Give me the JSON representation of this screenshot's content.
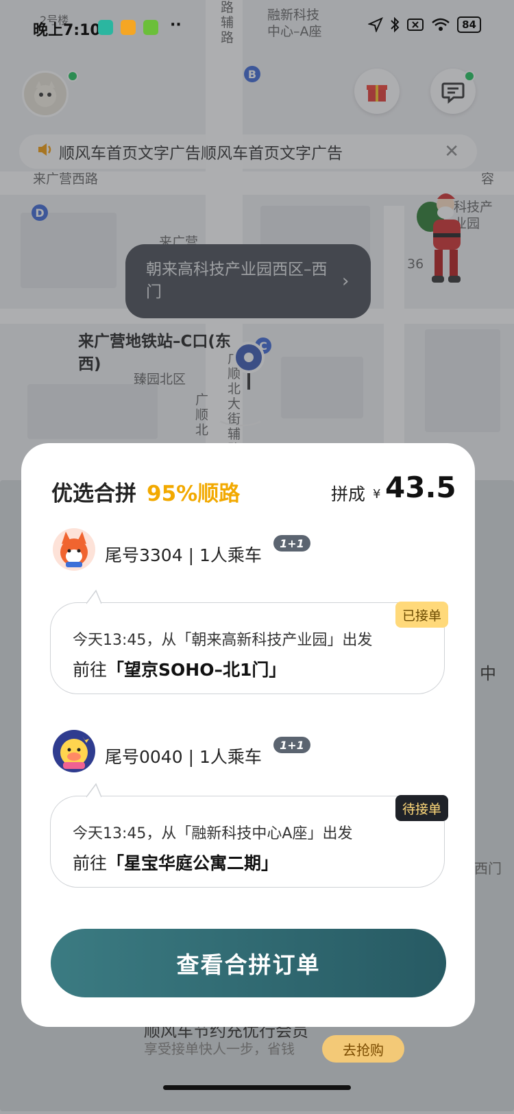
{
  "status_bar": {
    "time": "晚上7:10",
    "dots": "··",
    "battery": "84",
    "app_colors": [
      "#2bb6a0",
      "#f5a623",
      "#6bbf3a"
    ]
  },
  "map": {
    "labels": {
      "east_building": "融新科技\n中心–A座",
      "road_west": "来广营西路",
      "road_right": "容",
      "laiguangying": "来广营",
      "zhenyuan": "臻园北区",
      "num36": "36",
      "kechan": "科技产\n业园",
      "bldg_top": "2号楼"
    },
    "vertical_labels": {
      "road_top": "路辅路",
      "guangshun": "广顺北",
      "guangshun_main": "广顺北大街辅路"
    },
    "marks": [
      "B",
      "D",
      "C"
    ]
  },
  "notice_bar": {
    "text": "顺风车首页文字广告顺风车首页文字广告",
    "close": "✕"
  },
  "location_bubble": {
    "text": "朝来高科技产业园西区–西门",
    "chevron": "›"
  },
  "poi_label": "来广营地铁站–C口(东西)",
  "swipe_hint": "︶",
  "card": {
    "title": "优选合拼",
    "percent": "95%顺路",
    "price_label": "拼成",
    "currency": "¥",
    "price": "43.5",
    "passengers": [
      {
        "name": "尾号3304 | 1人乘车",
        "tag": "1+1",
        "status": "已接单",
        "line1": "今天13:45，从「朝来高新科技产业园」出发",
        "line2_prefix": "前往",
        "destination": "「望京SOHO–北1门」"
      },
      {
        "name": "尾号0040 | 1人乘车",
        "tag": "1+1",
        "status": "待接单",
        "line1": "今天13:45，从「融新科技中心A座」出发",
        "line2_prefix": "前往",
        "destination": "「星宝华庭公寓二期」"
      }
    ],
    "cta": "查看合拼订单"
  },
  "behind": {
    "edge_text_1": "中",
    "edge_text_2": "西门",
    "promo_title": "顺风车节约充优行会员",
    "promo_sub": "享受接单快人一步，省钱",
    "promo_btn": "去抢购"
  }
}
